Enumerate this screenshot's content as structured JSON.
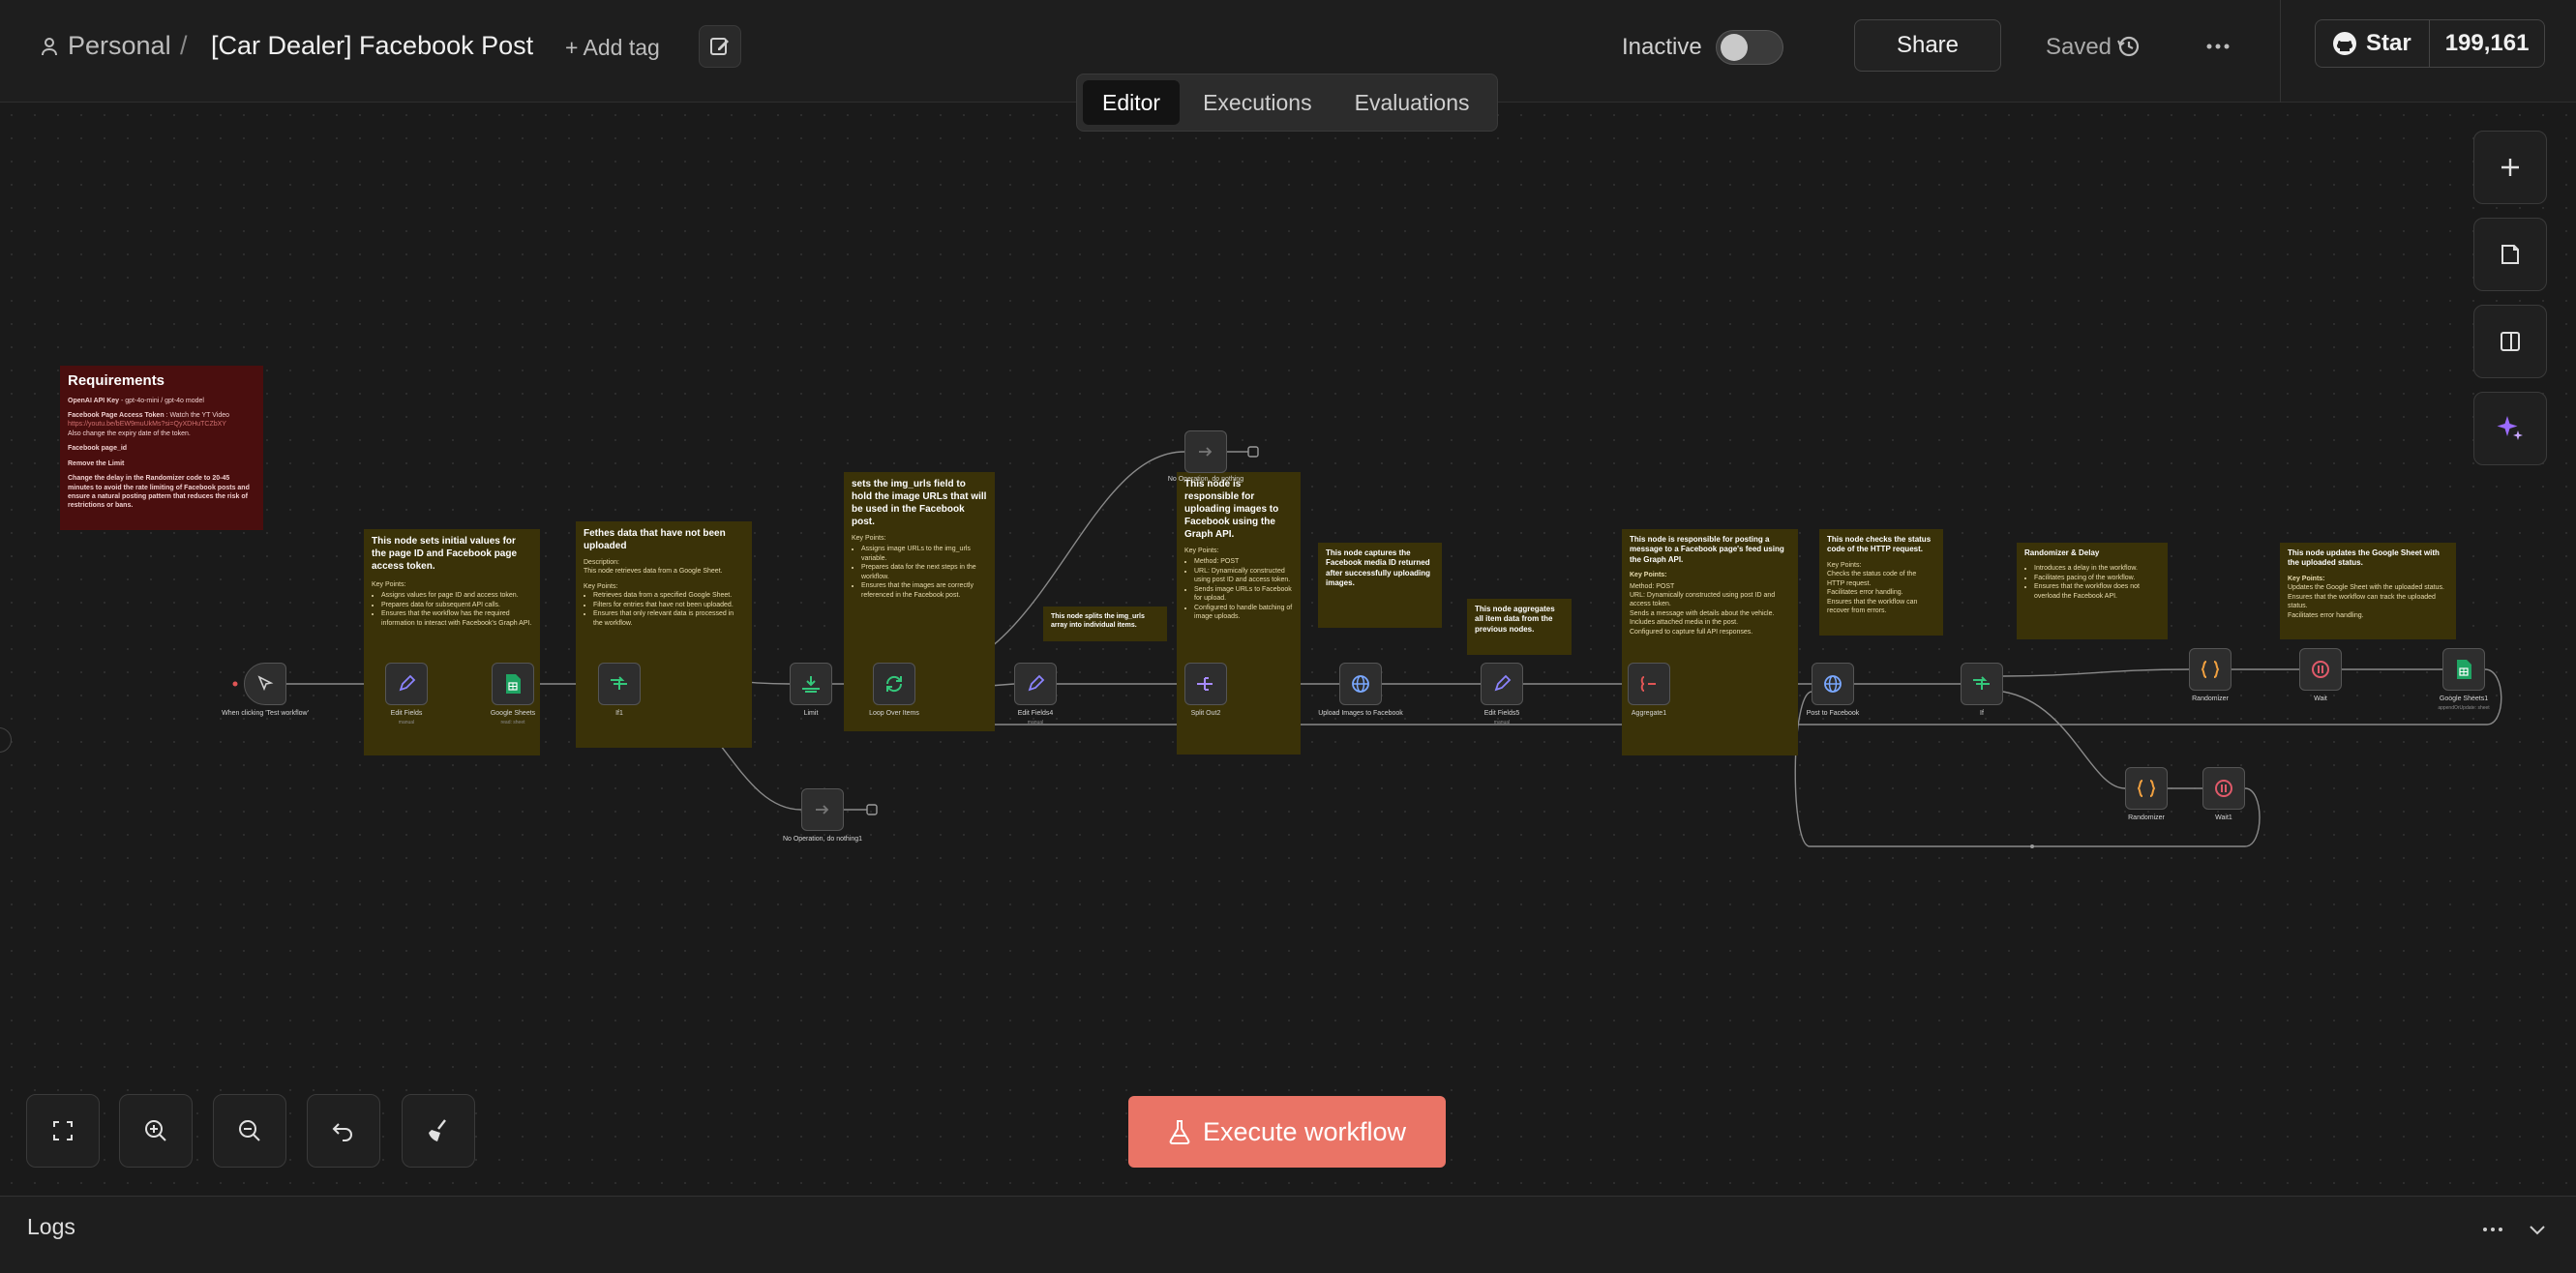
{
  "header": {
    "project": "Personal",
    "separator": "/",
    "workflow_title": "[Car Dealer] Facebook Post",
    "add_tag": "+ Add tag",
    "status_label": "Inactive",
    "share": "Share",
    "saved": "Saved",
    "github_star": "Star",
    "github_count": "199,161"
  },
  "tabs": [
    {
      "label": "Editor",
      "active": true
    },
    {
      "label": "Executions",
      "active": false
    },
    {
      "label": "Evaluations",
      "active": false
    }
  ],
  "execute_button": "Execute workflow",
  "logs": {
    "title": "Logs"
  },
  "stickies": {
    "requirements": {
      "title": "Requirements",
      "l1a": "OpenAI API Key",
      "l1b": " - gpt-4o-mini / gpt-4o model",
      "l2a": "Facebook Page Access Token",
      "l2b": " : Watch the YT Video",
      "l2link": "https://youtu.be/bEW9muUkMs?si=QyXDHuTCZbXY",
      "l3": "Also change the expiry date of the token.",
      "l4": "Facebook page_id",
      "l5": "Remove the Limit",
      "l6": "Change the delay in the Randomizer code to 20-45 minutes to avoid the rate limiting of Facebook posts and ensure a natural posting pattern that reduces the risk of restrictions or bans."
    },
    "s1": {
      "title": "This node sets initial values for the page ID and Facebook page access token.",
      "kp": "Key Points:",
      "b1": "Assigns values for page ID and access token.",
      "b2": "Prepares data for subsequent API calls.",
      "b3": "Ensures that the workflow has the required information to interact with Facebook's Graph API."
    },
    "s2": {
      "title": "Fethes data that have not been uploaded",
      "desc": "Description:",
      "d1": "This node retrieves data from a Google Sheet.",
      "kp": "Key Points:",
      "b1": "Retrieves data from a specified Google Sheet.",
      "b2": "Filters for entries that have not been uploaded.",
      "b3": "Ensures that only relevant data is processed in the workflow."
    },
    "s3": {
      "title": "sets the img_urls field to hold the image URLs that will be used in the Facebook post.",
      "kp": "Key Points:",
      "b1": "Assigns image URLs to the img_urls variable.",
      "b2": "Prepares data for the next steps in the workflow.",
      "b3": "Ensures that the images are correctly referenced in the Facebook post."
    },
    "s4": {
      "title": "This node splits the img_urls array into individual items."
    },
    "s5": {
      "title": "This node is responsible for uploading images to Facebook using the Graph API.",
      "kp": "Key Points:",
      "b1": "Method: POST",
      "b2": "URL: Dynamically constructed using post ID and access token.",
      "b3": "Sends image URLs to Facebook for upload.",
      "b4": "Configured to handle batching of image uploads."
    },
    "s6": {
      "title": "This node captures the Facebook media ID returned after successfully uploading images."
    },
    "s7": {
      "title": "This node aggregates all item data from the previous nodes."
    },
    "s8": {
      "title": "This node is responsible for posting a message to a Facebook page's feed using the Graph API.",
      "kp": "Key Points:",
      "d1": "Method: POST",
      "d2": "URL: Dynamically constructed using post ID and access token.",
      "d3": "Sends a message with details about the vehicle.",
      "d4": "Includes attached media in the post.",
      "d5": "Configured to capture full API responses."
    },
    "s9": {
      "title": "This node checks the status code of the HTTP request.",
      "kp": "Key Points:",
      "d1": "Checks the status code of the HTTP request.",
      "d2": "Facilitates error handling.",
      "d3": "Ensures that the workflow can recover from errors."
    },
    "s10": {
      "title": "Randomizer & Delay",
      "b1": "Introduces a delay in the workflow.",
      "b2": "Facilitates pacing of the workflow.",
      "b3": "Ensures that the workflow does not overload the Facebook API."
    },
    "s11": {
      "title": "This node updates the Google Sheet with the uploaded status.",
      "kp": "Key Points:",
      "d1": "Updates the Google Sheet with the uploaded status.",
      "d2": "Ensures that the workflow can track the uploaded status.",
      "d3": "Facilitates error handling."
    }
  },
  "nodes": {
    "trigger": {
      "label": "When clicking 'Test workflow'"
    },
    "edit_fields": {
      "label": "Edit Fields",
      "sub": "manual"
    },
    "google_sheets": {
      "label": "Google Sheets",
      "sub": "read: sheet"
    },
    "if1": {
      "label": "If1"
    },
    "limit": {
      "label": "Limit"
    },
    "loop": {
      "label": "Loop Over Items"
    },
    "edit_fields4": {
      "label": "Edit Fields4",
      "sub": "manual"
    },
    "split_out2": {
      "label": "Split Out2"
    },
    "upload_images": {
      "label": "Upload Images to Facebook"
    },
    "edit_fields5": {
      "label": "Edit Fields5",
      "sub": "manual"
    },
    "aggregate1": {
      "label": "Aggregate1"
    },
    "post_fb": {
      "label": "Post to Facebook"
    },
    "if": {
      "label": "If"
    },
    "randomizer_top": {
      "label": "Randomizer"
    },
    "wait": {
      "label": "Wait"
    },
    "google_sheets1": {
      "label": "Google Sheets1",
      "sub": "appendOrUpdate: sheet"
    },
    "randomizer_bottom": {
      "label": "Randomizer"
    },
    "wait1": {
      "label": "Wait1"
    },
    "noop_top": {
      "label": "No Operation, do nothing"
    },
    "noop_bottom": {
      "label": "No Operation, do nothing1"
    }
  },
  "colors": {
    "accent_execute": "#ea7466",
    "sticky_yellow": "#3a3208",
    "sticky_red": "#4a0e0e",
    "edge": "#8a8a8a"
  }
}
